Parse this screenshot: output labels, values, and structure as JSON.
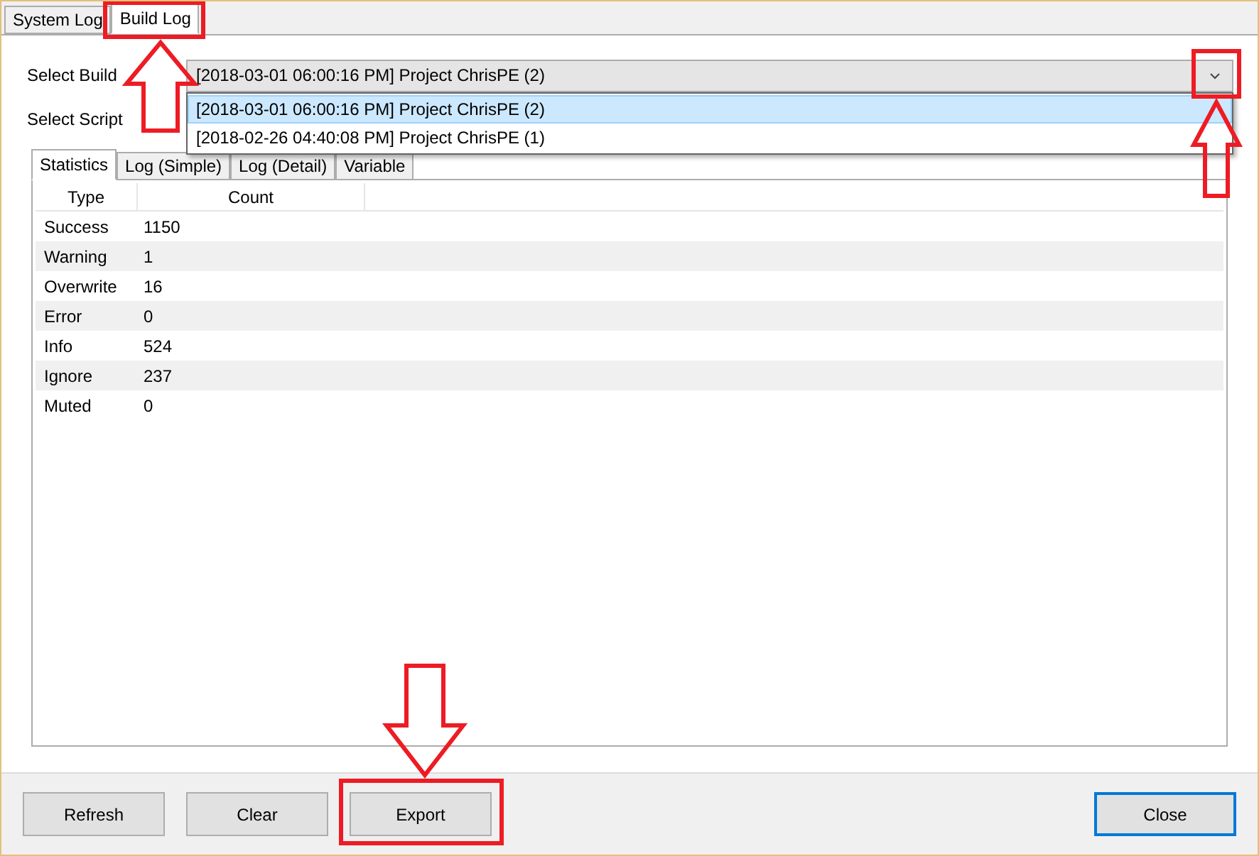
{
  "main_tabs": [
    {
      "label": "System Log",
      "selected": false
    },
    {
      "label": "Build Log",
      "selected": true
    }
  ],
  "select_build": {
    "label": "Select Build",
    "value": "[2018-03-01 06:00:16 PM] Project ChrisPE (2)",
    "expanded": true,
    "options": [
      {
        "label": "[2018-03-01 06:00:16 PM] Project ChrisPE (2)",
        "selected": true
      },
      {
        "label": "[2018-02-26 04:40:08 PM] Project ChrisPE (1)",
        "selected": false
      }
    ]
  },
  "select_script": {
    "label": "Select Script"
  },
  "log_tabs": [
    {
      "label": "Statistics",
      "selected": true
    },
    {
      "label": "Log (Simple)",
      "selected": false
    },
    {
      "label": "Log (Detail)",
      "selected": false
    },
    {
      "label": "Variable",
      "selected": false
    }
  ],
  "table": {
    "columns": [
      "Type",
      "Count"
    ],
    "rows": [
      [
        "Success",
        "1150"
      ],
      [
        "Warning",
        "1"
      ],
      [
        "Overwrite",
        "16"
      ],
      [
        "Error",
        "0"
      ],
      [
        "Info",
        "524"
      ],
      [
        "Ignore",
        "237"
      ],
      [
        "Muted",
        "0"
      ]
    ]
  },
  "buttons": [
    {
      "label": "Refresh",
      "default": false
    },
    {
      "label": "Clear",
      "default": false
    },
    {
      "label": "Export",
      "default": false
    },
    {
      "label": "Close",
      "default": true
    }
  ]
}
